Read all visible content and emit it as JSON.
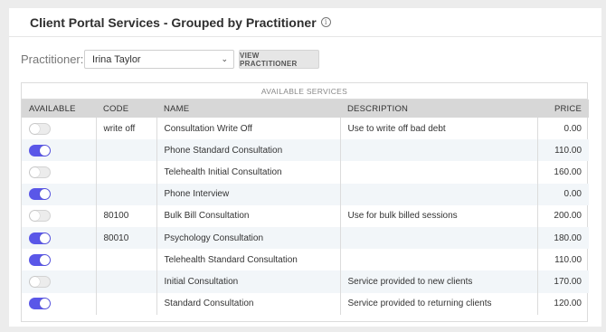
{
  "header": {
    "title": "Client Portal Services - Grouped by Practitioner"
  },
  "practitioner": {
    "label": "Practitioner:",
    "selected": "Irina Taylor",
    "button_label": "VIEW PRACTITIONER"
  },
  "table": {
    "caption": "AVAILABLE SERVICES",
    "columns": [
      "AVAILABLE",
      "CODE",
      "NAME",
      "DESCRIPTION",
      "PRICE"
    ],
    "rows": [
      {
        "available": false,
        "code": "write off",
        "name": "Consultation Write Off",
        "description": "Use to write off bad debt",
        "price": "0.00"
      },
      {
        "available": true,
        "code": "",
        "name": "Phone Standard Consultation",
        "description": "",
        "price": "110.00"
      },
      {
        "available": false,
        "code": "",
        "name": "Telehealth Initial Consultation",
        "description": "",
        "price": "160.00"
      },
      {
        "available": true,
        "code": "",
        "name": "Phone Interview",
        "description": "",
        "price": "0.00"
      },
      {
        "available": false,
        "code": "80100",
        "name": "Bulk Bill Consultation",
        "description": "Use for bulk billed sessions",
        "price": "200.00"
      },
      {
        "available": true,
        "code": "80010",
        "name": "Psychology Consultation",
        "description": "",
        "price": "180.00"
      },
      {
        "available": true,
        "code": "",
        "name": "Telehealth Standard Consultation",
        "description": "",
        "price": "110.00"
      },
      {
        "available": false,
        "code": "",
        "name": "Initial Consultation",
        "description": "Service provided to new clients",
        "price": "170.00"
      },
      {
        "available": true,
        "code": "",
        "name": "Standard Consultation",
        "description": "Service provided to returning clients",
        "price": "120.00"
      }
    ]
  },
  "colors": {
    "toggle_on": "#5a57e8",
    "header_bg": "#d7d7d7"
  }
}
